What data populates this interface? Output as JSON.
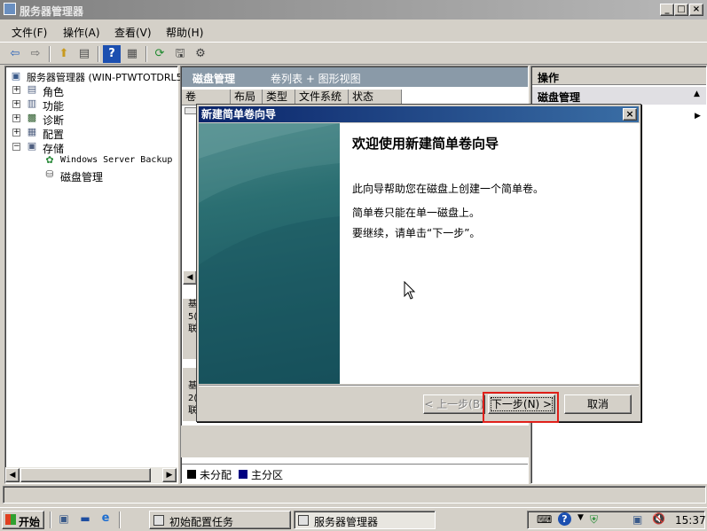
{
  "window": {
    "title": "服务器管理器",
    "controls": {
      "minimize": "_",
      "restore": "□",
      "close": "×"
    }
  },
  "menu": [
    "文件(F)",
    "操作(A)",
    "查看(V)",
    "帮助(H)"
  ],
  "tree": {
    "root": "服务器管理器 (WIN-PTWTOTDRL5",
    "items": [
      {
        "label": "角色",
        "expander": "+"
      },
      {
        "label": "功能",
        "expander": "+"
      },
      {
        "label": "诊断",
        "expander": "+"
      },
      {
        "label": "配置",
        "expander": "+"
      },
      {
        "label": "存储",
        "expander": "−"
      }
    ],
    "children": [
      "Windows Server Backup",
      "磁盘管理"
    ]
  },
  "middle": {
    "header_title": "磁盘管理",
    "header_view": "卷列表 + 图形视图",
    "columns": [
      "卷",
      "布局",
      "类型",
      "文件系统",
      "状态"
    ],
    "disk_labels": [
      "基",
      "5(",
      "联",
      "基",
      "2(",
      "联"
    ],
    "legend": [
      {
        "label": "未分配",
        "color": "#000000"
      },
      {
        "label": "主分区",
        "color": "#000080"
      }
    ]
  },
  "actions": {
    "header": "操作",
    "section": "磁盘管理"
  },
  "dialog": {
    "title": "新建简单卷向导",
    "heading": "欢迎使用新建简单卷向导",
    "para1": "此向导帮助您在磁盘上创建一个简单卷。",
    "para2": "简单卷只能在单一磁盘上。",
    "para3": "要继续，请单击“下一步”。",
    "back_button": "< 上一步(B)",
    "next_button": "下一步(N) >",
    "cancel_button": "取消",
    "close": "×"
  },
  "taskbar": {
    "start": "开始",
    "tasks": [
      "初始配置任务",
      "服务器管理器"
    ],
    "clock": "15:37"
  }
}
